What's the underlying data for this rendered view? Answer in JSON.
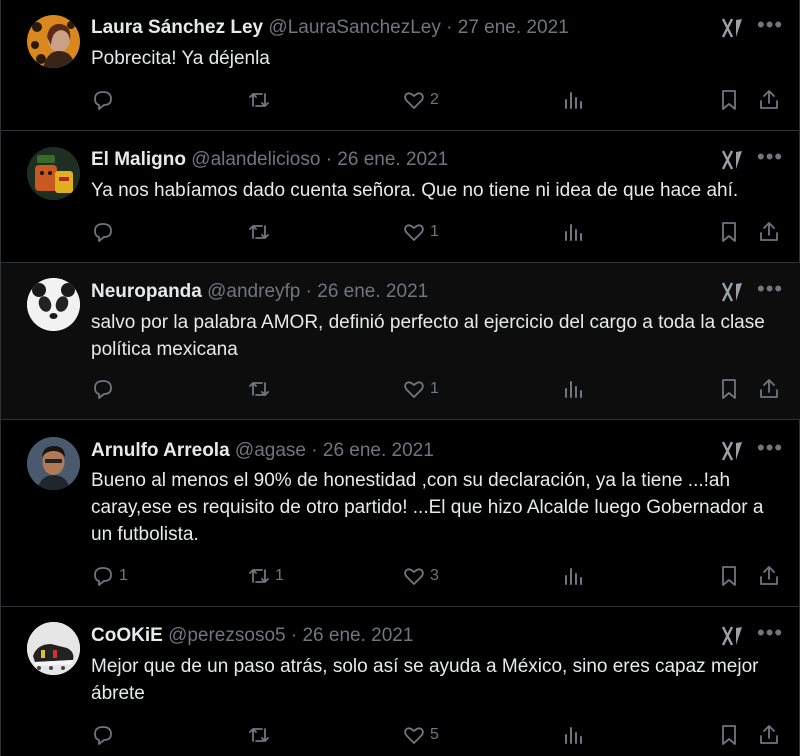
{
  "tweets": [
    {
      "name": "Laura Sánchez Ley",
      "handle": "@LauraSanchezLey",
      "date": "· 27 ene. 2021",
      "text": "Pobrecita! Ya déjenla",
      "replies": "",
      "retweets": "",
      "likes": "2"
    },
    {
      "name": "El Maligno",
      "handle": "@alandelicioso",
      "date": "· 26 ene. 2021",
      "text": "Ya nos habíamos dado cuenta señora. Que no tiene ni idea de que hace ahí.",
      "replies": "",
      "retweets": "",
      "likes": "1"
    },
    {
      "name": "Neuropanda",
      "handle": "@andreyfp",
      "date": "· 26 ene. 2021",
      "text": "salvo por la palabra AMOR, definió perfecto al ejercicio del cargo a toda la clase política mexicana",
      "replies": "",
      "retweets": "",
      "likes": "1"
    },
    {
      "name": "Arnulfo Arreola",
      "handle": "@agase",
      "date": "· 26 ene. 2021",
      "text": "Bueno al menos el 90% de honestidad ,con su declaración, ya la tiene ...!ah caray,ese es requisito de otro partido! ...El que hizo Alcalde luego Gobernador a un futbolista.",
      "replies": "1",
      "retweets": "1",
      "likes": "3"
    },
    {
      "name": "CoOKiE",
      "handle": "@perezsoso5",
      "date": "· 26 ene. 2021",
      "text": "Mejor que de un paso atrás, solo así se ayuda a México, sino eres capaz mejor ábrete",
      "replies": "",
      "retweets": "",
      "likes": "5"
    }
  ],
  "colors": {
    "background": "#000000",
    "text": "#e7e9ea",
    "muted": "#71767b",
    "border": "#2f3336"
  },
  "icons": [
    "reply-icon",
    "retweet-icon",
    "like-icon",
    "views-icon",
    "bookmark-icon",
    "share-icon",
    "grok-icon",
    "more-icon"
  ]
}
